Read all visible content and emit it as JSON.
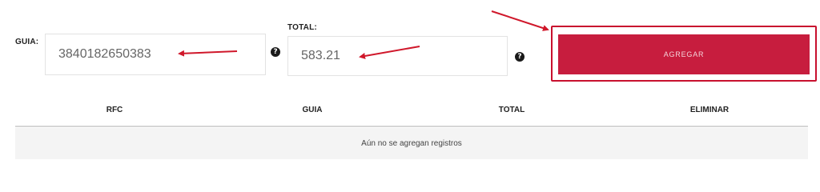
{
  "form": {
    "guia": {
      "label": "GUIA:",
      "value": "3840182650383"
    },
    "total": {
      "label": "TOTAL:",
      "value": "583.21"
    },
    "help_glyph": "?",
    "add_button_label": "AGREGAR"
  },
  "table": {
    "columns": [
      "RFC",
      "GUIA",
      "TOTAL",
      "ELIMINAR"
    ],
    "empty_message": "Aún no se agregan registros"
  },
  "colors": {
    "accent": "#c71d3e",
    "annotation": "#c8102e"
  },
  "icons": [
    "help-icon",
    "annotation-arrow"
  ]
}
